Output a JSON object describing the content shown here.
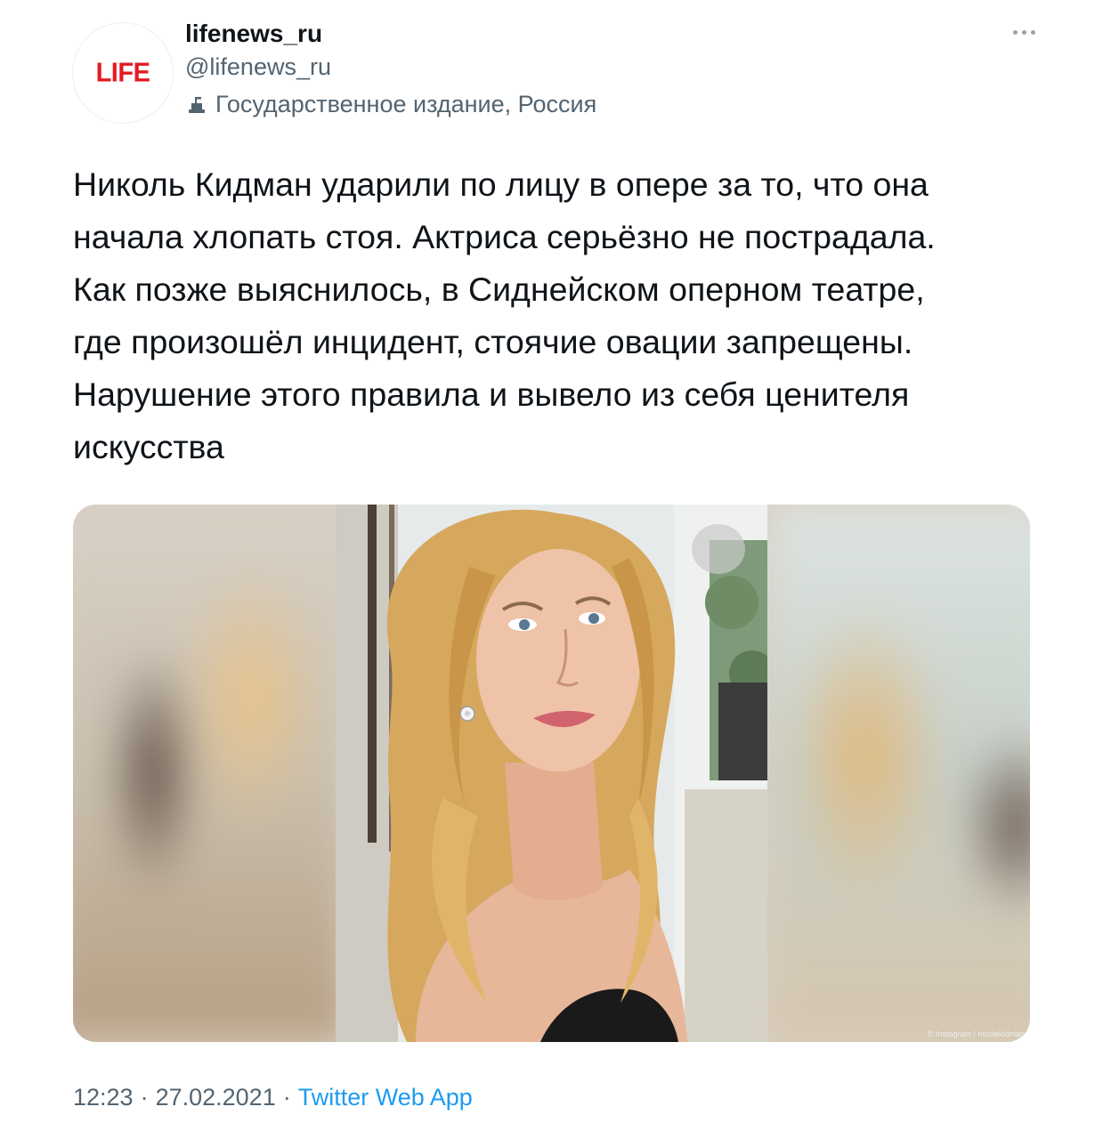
{
  "author": {
    "display_name": "lifenews_ru",
    "handle": "@lifenews_ru",
    "avatar_logo_text": "LIFE",
    "label": "Государственное издание, Россия",
    "label_icon": "podium-icon"
  },
  "tweet": {
    "text": "Николь Кидман ударили по лицу в опере за то, что она\nначала хлопать стоя. Актриса серьёзно не пострадала.\nКак позже выяснилось, в Сиднейском оперном театре,\nгде произошёл инцидент, стоячие овации запрещены.\nНарушение этого правила и вывело из себя ценителя\nискусства",
    "media_credit": "© Instagram / nicolekidman"
  },
  "meta": {
    "time": "12:23",
    "separator": "·",
    "date": "27.02.2021",
    "source": "Twitter Web App"
  },
  "colors": {
    "brand_red": "#e21b24",
    "secondary_text": "#536471",
    "link_blue": "#1d9bf0"
  }
}
